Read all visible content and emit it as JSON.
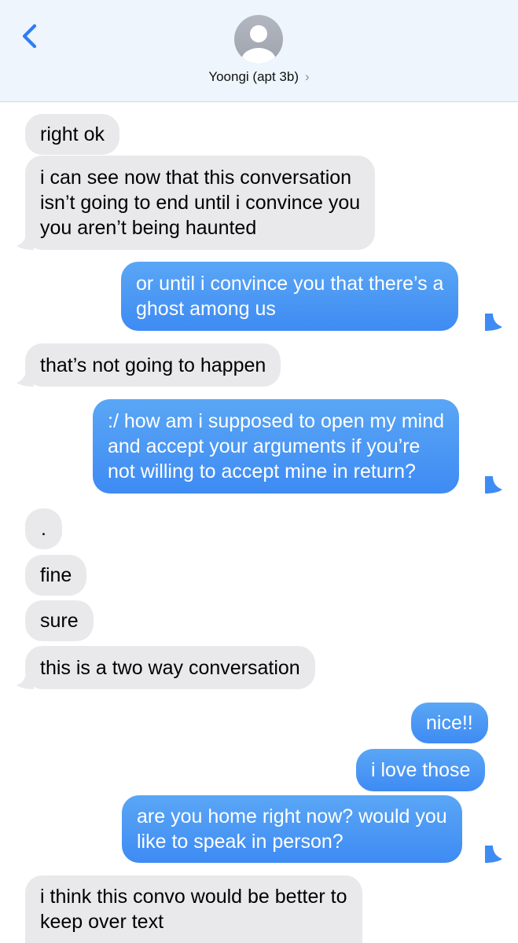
{
  "header": {
    "contact_name": "Yoongi (apt 3b)",
    "chevron": "›",
    "icons": {
      "back": "chevron-left-icon",
      "avatar": "person-silhouette-icon",
      "details": "chevron-right-icon"
    }
  },
  "colors": {
    "header_bg": "#eef5fd",
    "accent": "#2f7cf6",
    "incoming_bubble": "#e9e9eb",
    "outgoing_bubble": "#3e8bf4"
  },
  "messages": [
    {
      "from": "contact",
      "text": "right ok"
    },
    {
      "from": "contact",
      "text": "i can see now that this conversation\nisn’t going to end until i convince you\nyou aren’t being haunted"
    },
    {
      "from": "me",
      "text": "or until i convince you that there’s a\nghost among us"
    },
    {
      "from": "contact",
      "text": "that’s not going to happen"
    },
    {
      "from": "me",
      "text": ":/ how am i supposed to open my mind\nand accept your arguments if you’re\nnot willing to accept mine in return?"
    },
    {
      "from": "contact",
      "text": "."
    },
    {
      "from": "contact",
      "text": "fine"
    },
    {
      "from": "contact",
      "text": "sure"
    },
    {
      "from": "contact",
      "text": "this is a two way conversation"
    },
    {
      "from": "me",
      "text": "nice!!"
    },
    {
      "from": "me",
      "text": "i love those"
    },
    {
      "from": "me",
      "text": "are you home right now? would you\nlike to speak in person?"
    },
    {
      "from": "contact",
      "text": "i think this convo would be better to\nkeep over text"
    }
  ]
}
